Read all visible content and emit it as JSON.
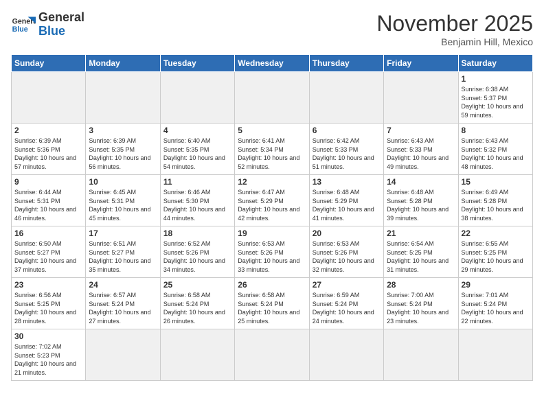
{
  "logo": {
    "text_general": "General",
    "text_blue": "Blue"
  },
  "header": {
    "month": "November 2025",
    "location": "Benjamin Hill, Mexico"
  },
  "weekdays": [
    "Sunday",
    "Monday",
    "Tuesday",
    "Wednesday",
    "Thursday",
    "Friday",
    "Saturday"
  ],
  "weeks": [
    [
      {
        "day": "",
        "info": "",
        "empty": true
      },
      {
        "day": "",
        "info": "",
        "empty": true
      },
      {
        "day": "",
        "info": "",
        "empty": true
      },
      {
        "day": "",
        "info": "",
        "empty": true
      },
      {
        "day": "",
        "info": "",
        "empty": true
      },
      {
        "day": "",
        "info": "",
        "empty": true
      },
      {
        "day": "1",
        "info": "Sunrise: 6:38 AM\nSunset: 5:37 PM\nDaylight: 10 hours and 59 minutes."
      }
    ],
    [
      {
        "day": "2",
        "info": "Sunrise: 6:39 AM\nSunset: 5:36 PM\nDaylight: 10 hours and 57 minutes."
      },
      {
        "day": "3",
        "info": "Sunrise: 6:39 AM\nSunset: 5:35 PM\nDaylight: 10 hours and 56 minutes."
      },
      {
        "day": "4",
        "info": "Sunrise: 6:40 AM\nSunset: 5:35 PM\nDaylight: 10 hours and 54 minutes."
      },
      {
        "day": "5",
        "info": "Sunrise: 6:41 AM\nSunset: 5:34 PM\nDaylight: 10 hours and 52 minutes."
      },
      {
        "day": "6",
        "info": "Sunrise: 6:42 AM\nSunset: 5:33 PM\nDaylight: 10 hours and 51 minutes."
      },
      {
        "day": "7",
        "info": "Sunrise: 6:43 AM\nSunset: 5:33 PM\nDaylight: 10 hours and 49 minutes."
      },
      {
        "day": "8",
        "info": "Sunrise: 6:43 AM\nSunset: 5:32 PM\nDaylight: 10 hours and 48 minutes."
      }
    ],
    [
      {
        "day": "9",
        "info": "Sunrise: 6:44 AM\nSunset: 5:31 PM\nDaylight: 10 hours and 46 minutes."
      },
      {
        "day": "10",
        "info": "Sunrise: 6:45 AM\nSunset: 5:31 PM\nDaylight: 10 hours and 45 minutes."
      },
      {
        "day": "11",
        "info": "Sunrise: 6:46 AM\nSunset: 5:30 PM\nDaylight: 10 hours and 44 minutes."
      },
      {
        "day": "12",
        "info": "Sunrise: 6:47 AM\nSunset: 5:29 PM\nDaylight: 10 hours and 42 minutes."
      },
      {
        "day": "13",
        "info": "Sunrise: 6:48 AM\nSunset: 5:29 PM\nDaylight: 10 hours and 41 minutes."
      },
      {
        "day": "14",
        "info": "Sunrise: 6:48 AM\nSunset: 5:28 PM\nDaylight: 10 hours and 39 minutes."
      },
      {
        "day": "15",
        "info": "Sunrise: 6:49 AM\nSunset: 5:28 PM\nDaylight: 10 hours and 38 minutes."
      }
    ],
    [
      {
        "day": "16",
        "info": "Sunrise: 6:50 AM\nSunset: 5:27 PM\nDaylight: 10 hours and 37 minutes."
      },
      {
        "day": "17",
        "info": "Sunrise: 6:51 AM\nSunset: 5:27 PM\nDaylight: 10 hours and 35 minutes."
      },
      {
        "day": "18",
        "info": "Sunrise: 6:52 AM\nSunset: 5:26 PM\nDaylight: 10 hours and 34 minutes."
      },
      {
        "day": "19",
        "info": "Sunrise: 6:53 AM\nSunset: 5:26 PM\nDaylight: 10 hours and 33 minutes."
      },
      {
        "day": "20",
        "info": "Sunrise: 6:53 AM\nSunset: 5:26 PM\nDaylight: 10 hours and 32 minutes."
      },
      {
        "day": "21",
        "info": "Sunrise: 6:54 AM\nSunset: 5:25 PM\nDaylight: 10 hours and 31 minutes."
      },
      {
        "day": "22",
        "info": "Sunrise: 6:55 AM\nSunset: 5:25 PM\nDaylight: 10 hours and 29 minutes."
      }
    ],
    [
      {
        "day": "23",
        "info": "Sunrise: 6:56 AM\nSunset: 5:25 PM\nDaylight: 10 hours and 28 minutes."
      },
      {
        "day": "24",
        "info": "Sunrise: 6:57 AM\nSunset: 5:24 PM\nDaylight: 10 hours and 27 minutes."
      },
      {
        "day": "25",
        "info": "Sunrise: 6:58 AM\nSunset: 5:24 PM\nDaylight: 10 hours and 26 minutes."
      },
      {
        "day": "26",
        "info": "Sunrise: 6:58 AM\nSunset: 5:24 PM\nDaylight: 10 hours and 25 minutes."
      },
      {
        "day": "27",
        "info": "Sunrise: 6:59 AM\nSunset: 5:24 PM\nDaylight: 10 hours and 24 minutes."
      },
      {
        "day": "28",
        "info": "Sunrise: 7:00 AM\nSunset: 5:24 PM\nDaylight: 10 hours and 23 minutes."
      },
      {
        "day": "29",
        "info": "Sunrise: 7:01 AM\nSunset: 5:24 PM\nDaylight: 10 hours and 22 minutes."
      }
    ],
    [
      {
        "day": "30",
        "info": "Sunrise: 7:02 AM\nSunset: 5:23 PM\nDaylight: 10 hours and 21 minutes."
      },
      {
        "day": "",
        "info": "",
        "empty": true
      },
      {
        "day": "",
        "info": "",
        "empty": true
      },
      {
        "day": "",
        "info": "",
        "empty": true
      },
      {
        "day": "",
        "info": "",
        "empty": true
      },
      {
        "day": "",
        "info": "",
        "empty": true
      },
      {
        "day": "",
        "info": "",
        "empty": true
      }
    ]
  ]
}
